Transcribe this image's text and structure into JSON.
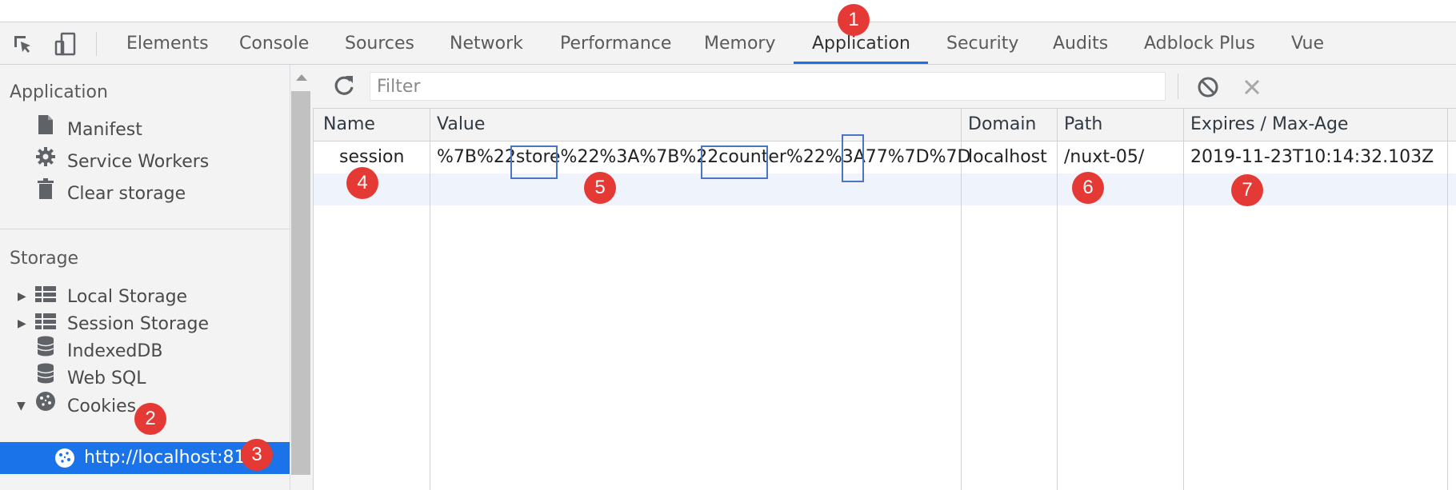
{
  "tabs": [
    {
      "label": "Elements"
    },
    {
      "label": "Console"
    },
    {
      "label": "Sources"
    },
    {
      "label": "Network"
    },
    {
      "label": "Performance"
    },
    {
      "label": "Memory"
    },
    {
      "label": "Application",
      "active": true
    },
    {
      "label": "Security"
    },
    {
      "label": "Audits"
    },
    {
      "label": "Adblock Plus"
    },
    {
      "label": "Vue"
    }
  ],
  "sidebar": {
    "application_heading": "Application",
    "application_items": [
      {
        "label": "Manifest",
        "icon": "document-icon"
      },
      {
        "label": "Service Workers",
        "icon": "gear-icon"
      },
      {
        "label": "Clear storage",
        "icon": "trash-icon"
      }
    ],
    "storage_heading": "Storage",
    "storage_items": [
      {
        "label": "Local Storage",
        "icon": "grid-icon",
        "expandable": true
      },
      {
        "label": "Session Storage",
        "icon": "grid-icon",
        "expandable": true
      },
      {
        "label": "IndexedDB",
        "icon": "database-icon"
      },
      {
        "label": "Web SQL",
        "icon": "database-icon"
      },
      {
        "label": "Cookies",
        "icon": "cookie-icon",
        "expanded": true
      }
    ],
    "selected_item": {
      "label": "http://localhost:81",
      "icon": "cookie-icon"
    }
  },
  "toolbar": {
    "filter_placeholder": "Filter"
  },
  "table": {
    "columns": [
      "Name",
      "Value",
      "Domain",
      "Path",
      "Expires / Max-Age"
    ],
    "rows": [
      {
        "name": "session",
        "value": "%7B%22store%22%3A%7B%22counter%22%3A77%7D%7D",
        "domain": "localhost",
        "path": "/nuxt-05/",
        "expires": "2019-11-23T10:14:32.103Z"
      }
    ]
  },
  "annotations": [
    "1",
    "2",
    "3",
    "4",
    "5",
    "6",
    "7"
  ],
  "colors": {
    "accent": "#1a73e8",
    "badge": "#e53935",
    "highlight_box": "#4a74c4",
    "selected_row": "#eef3fc"
  }
}
